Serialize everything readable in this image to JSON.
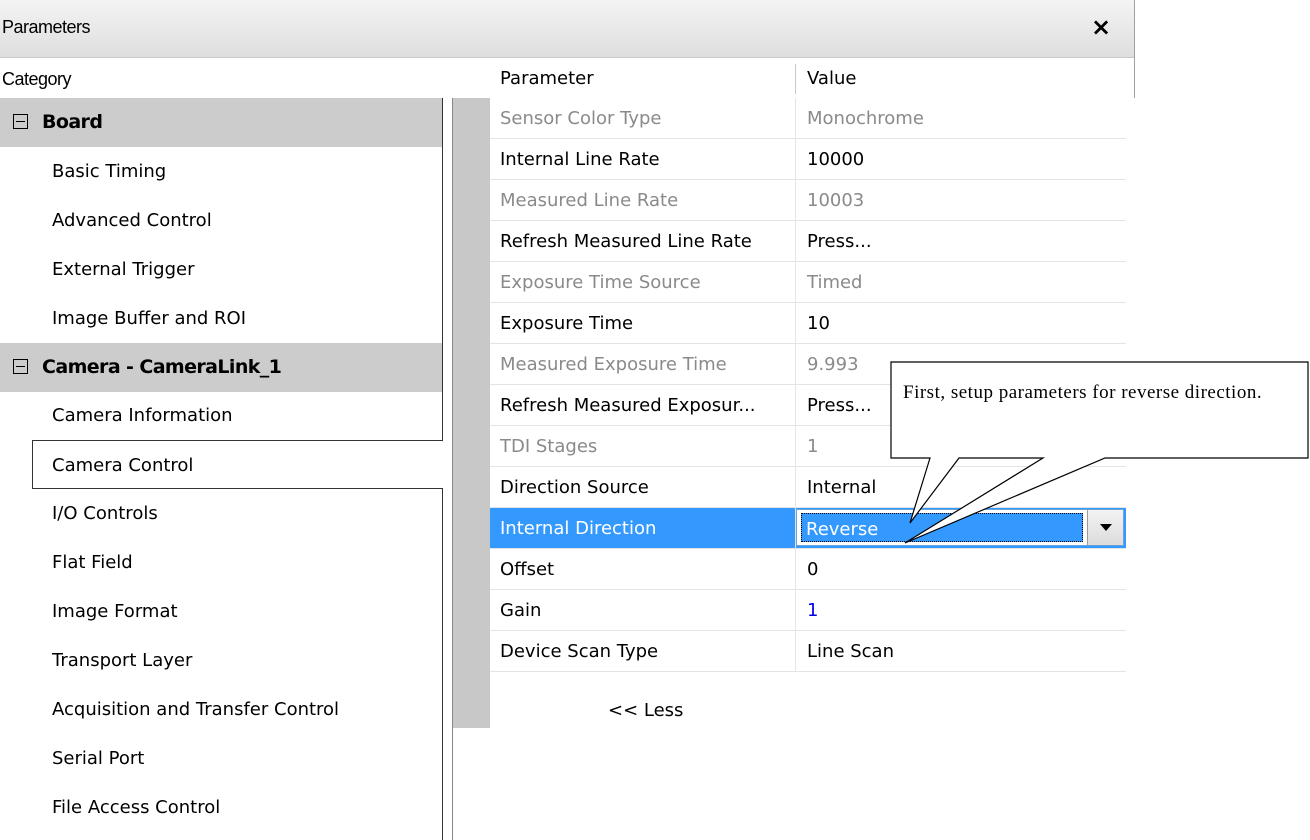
{
  "window": {
    "title": "Parameters",
    "close_label": "×"
  },
  "headers": {
    "category": "Category",
    "parameter": "Parameter",
    "value": "Value"
  },
  "categories": [
    {
      "label": "Board",
      "type": "group"
    },
    {
      "label": "Basic Timing",
      "type": "item"
    },
    {
      "label": "Advanced Control",
      "type": "item"
    },
    {
      "label": "External Trigger",
      "type": "item"
    },
    {
      "label": "Image Buffer and ROI",
      "type": "item"
    },
    {
      "label": "Camera - CameraLink_1",
      "type": "group"
    },
    {
      "label": "Camera Information",
      "type": "item"
    },
    {
      "label": "Camera Control",
      "type": "item",
      "selected": true
    },
    {
      "label": "I/O Controls",
      "type": "item"
    },
    {
      "label": "Flat Field",
      "type": "item"
    },
    {
      "label": "Image Format",
      "type": "item"
    },
    {
      "label": "Transport Layer",
      "type": "item"
    },
    {
      "label": "Acquisition and Transfer Control",
      "type": "item"
    },
    {
      "label": "Serial Port",
      "type": "item"
    },
    {
      "label": "File Access Control",
      "type": "item"
    }
  ],
  "parameters": [
    {
      "name": "Sensor Color Type",
      "value": "Monochrome",
      "readonly": true
    },
    {
      "name": "Internal Line Rate",
      "value": "10000",
      "readonly": false
    },
    {
      "name": "Measured Line Rate",
      "value": "10003",
      "readonly": true
    },
    {
      "name": "Refresh Measured Line Rate",
      "value": "Press...",
      "readonly": false
    },
    {
      "name": "Exposure Time Source",
      "value": "Timed",
      "readonly": true
    },
    {
      "name": "Exposure Time",
      "value": "10",
      "readonly": false
    },
    {
      "name": "Measured Exposure Time",
      "value": "9.993",
      "readonly": true
    },
    {
      "name": "Refresh Measured Exposur...",
      "value": "Press...",
      "readonly": false
    },
    {
      "name": "TDI Stages",
      "value": "1",
      "readonly": true
    },
    {
      "name": "Direction Source",
      "value": "Internal",
      "readonly": false
    },
    {
      "name": "Internal Direction",
      "value": "Reverse",
      "readonly": false,
      "selected": true
    },
    {
      "name": "Offset",
      "value": "0",
      "readonly": false
    },
    {
      "name": "Gain",
      "value": "1",
      "readonly": false,
      "value_color": "#0000ee"
    },
    {
      "name": "Device Scan Type",
      "value": "Line Scan",
      "readonly": false
    }
  ],
  "less_button": "<< Less",
  "callout": {
    "text": "First, setup parameters for reverse direction."
  },
  "colors": {
    "selection": "#3399ff",
    "group_bg": "#cccccc",
    "readonly_text": "#8a8a8a"
  }
}
